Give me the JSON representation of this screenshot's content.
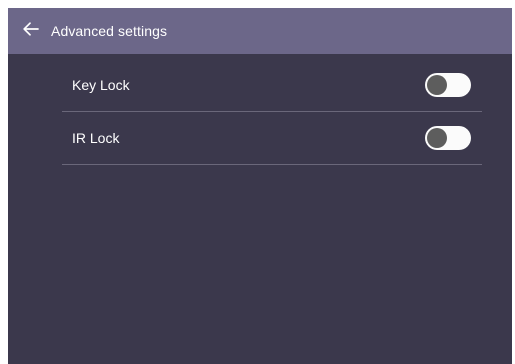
{
  "header": {
    "title": "Advanced settings",
    "back_icon": "arrow-left-icon"
  },
  "settings": [
    {
      "label": "Key Lock",
      "enabled": false
    },
    {
      "label": "IR Lock",
      "enabled": false
    }
  ],
  "colors": {
    "header_bg": "#6c6789",
    "panel_bg": "#3b384c",
    "divider": "#6a677a",
    "toggle_track": "#fbfbfb",
    "toggle_knob": "#5d5d5d"
  }
}
